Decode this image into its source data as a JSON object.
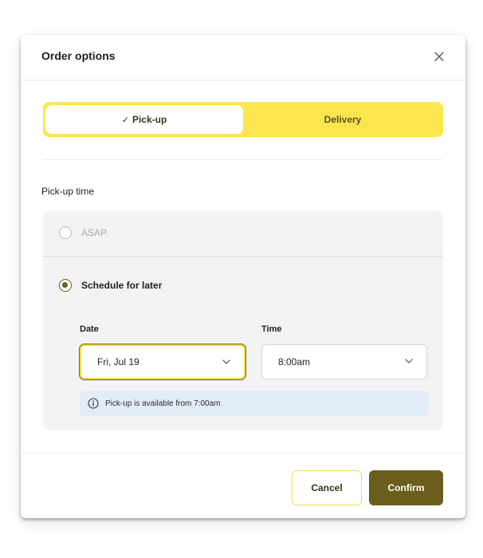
{
  "modal": {
    "title": "Order options",
    "close_icon": "close-icon"
  },
  "order_type": {
    "options": [
      {
        "label": "Pick-up",
        "selected": true,
        "icon": "check-icon"
      },
      {
        "label": "Delivery",
        "selected": false
      }
    ],
    "check_glyph": "✓"
  },
  "pickup_time": {
    "label": "Pick-up time",
    "options": [
      {
        "label": "ASAP",
        "selected": false,
        "disabled": true
      },
      {
        "label": "Schedule for later",
        "selected": true
      }
    ]
  },
  "schedule": {
    "date_label": "Date",
    "date_value": "Fri, Jul 19",
    "time_label": "Time",
    "time_value": "8:00am",
    "info_text": "Pick-up is available from 7:00am",
    "info_icon": "info-icon"
  },
  "footer": {
    "cancel_label": "Cancel",
    "confirm_label": "Confirm"
  },
  "colors": {
    "accent_yellow": "#fbe64d",
    "confirm_olive": "#6b5d1b",
    "info_bg": "#e3edf9",
    "panel_bg": "#f3f3f3"
  }
}
